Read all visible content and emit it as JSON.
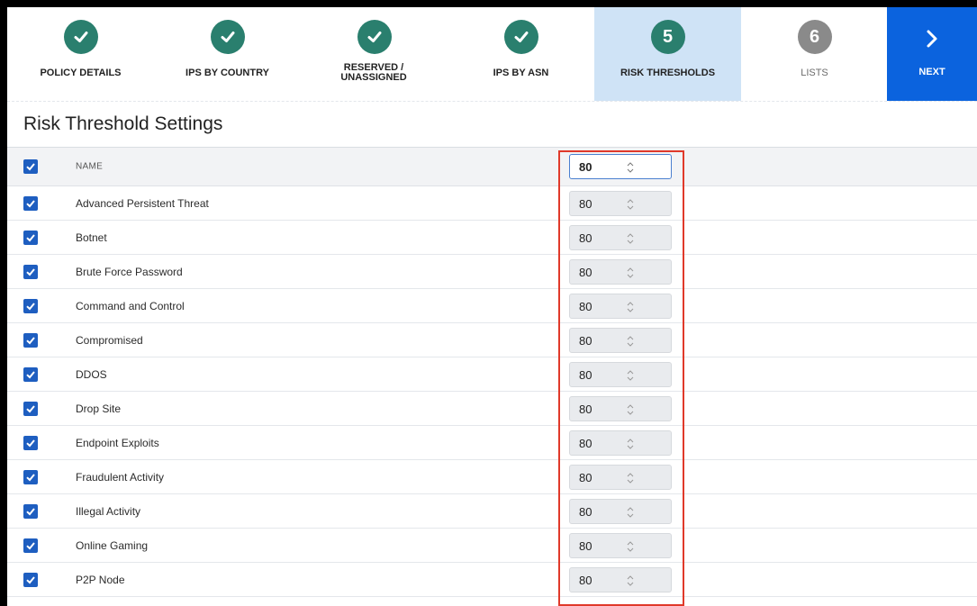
{
  "wizard": {
    "steps": [
      {
        "label": "POLICY DETAILS",
        "state": "done",
        "icon": "check-icon"
      },
      {
        "label": "IPS BY COUNTRY",
        "state": "done",
        "icon": "check-icon"
      },
      {
        "label": "RESERVED / UNASSIGNED",
        "state": "done",
        "icon": "check-icon"
      },
      {
        "label": "IPS BY ASN",
        "state": "done",
        "icon": "check-icon"
      },
      {
        "label": "RISK THRESHOLDS",
        "state": "current",
        "number": "5"
      },
      {
        "label": "LISTS",
        "state": "future",
        "number": "6"
      }
    ],
    "next_label": "NEXT"
  },
  "section_title": "Risk Threshold Settings",
  "table": {
    "header": {
      "name": "NAME",
      "value": "80"
    },
    "rows": [
      {
        "name": "Advanced Persistent Threat",
        "value": "80"
      },
      {
        "name": "Botnet",
        "value": "80"
      },
      {
        "name": "Brute Force Password",
        "value": "80"
      },
      {
        "name": "Command and Control",
        "value": "80"
      },
      {
        "name": "Compromised",
        "value": "80"
      },
      {
        "name": "DDOS",
        "value": "80"
      },
      {
        "name": "Drop Site",
        "value": "80"
      },
      {
        "name": "Endpoint Exploits",
        "value": "80"
      },
      {
        "name": "Fraudulent Activity",
        "value": "80"
      },
      {
        "name": "Illegal Activity",
        "value": "80"
      },
      {
        "name": "Online Gaming",
        "value": "80"
      },
      {
        "name": "P2P Node",
        "value": "80"
      }
    ]
  },
  "colors": {
    "step_done": "#2a7f6e",
    "step_future": "#8a8a8a",
    "current_step_bg": "#cfe3f6",
    "next_button": "#0b63de",
    "checkbox": "#1e5ec0",
    "highlight_box": "#e0392a"
  }
}
